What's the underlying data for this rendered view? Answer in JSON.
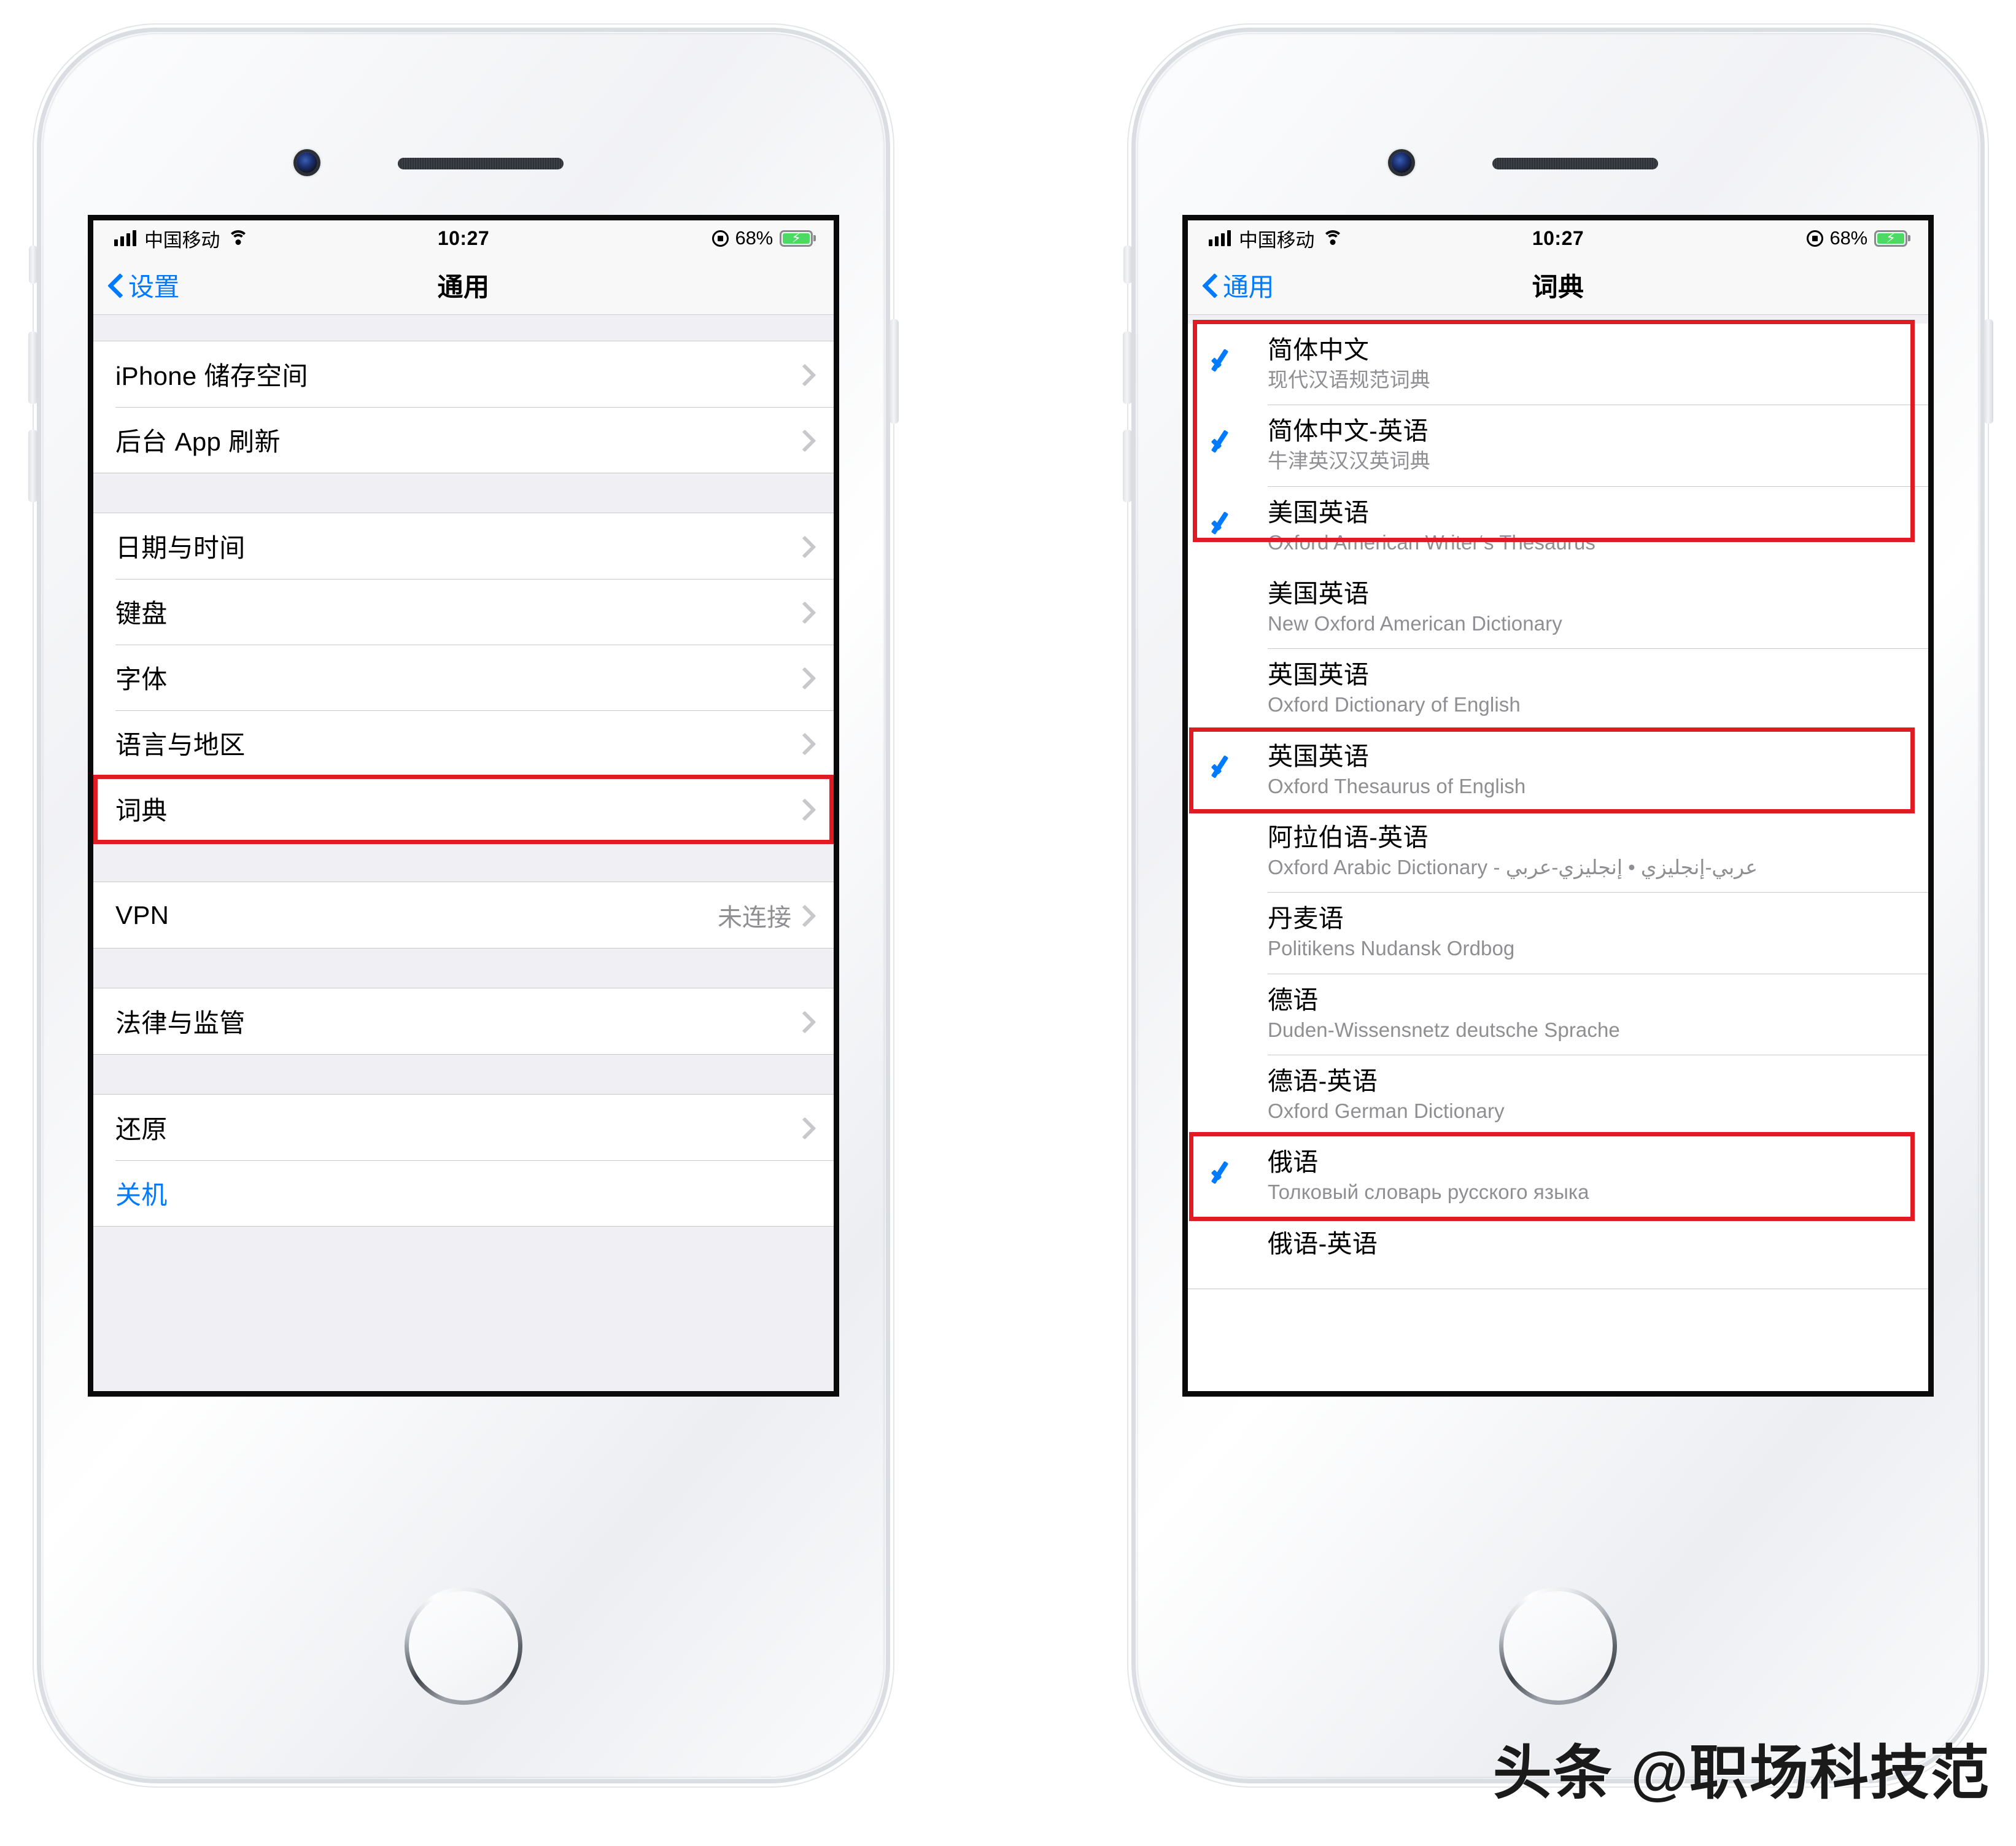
{
  "status_bar": {
    "carrier": "中国移动",
    "time": "10:27",
    "battery_percent": "68%",
    "signal_icon": "signal-bars-icon",
    "wifi_icon": "wifi-icon",
    "rotation_lock_icon": "rotation-lock-icon",
    "battery_icon": "battery-charging-icon"
  },
  "left_phone": {
    "nav": {
      "back_label": "设置",
      "title": "通用",
      "back_icon": "chevron-left-icon"
    },
    "groups": [
      {
        "rows": [
          {
            "label": "iPhone 储存空间",
            "value": "",
            "accessory": "chevron-right-icon"
          },
          {
            "label": "后台 App 刷新",
            "value": "",
            "accessory": "chevron-right-icon"
          }
        ]
      },
      {
        "rows": [
          {
            "label": "日期与时间",
            "value": "",
            "accessory": "chevron-right-icon"
          },
          {
            "label": "键盘",
            "value": "",
            "accessory": "chevron-right-icon"
          },
          {
            "label": "字体",
            "value": "",
            "accessory": "chevron-right-icon"
          },
          {
            "label": "语言与地区",
            "value": "",
            "accessory": "chevron-right-icon"
          },
          {
            "label": "词典",
            "value": "",
            "accessory": "chevron-right-icon",
            "highlighted": true
          }
        ]
      },
      {
        "rows": [
          {
            "label": "VPN",
            "value": "未连接",
            "accessory": "chevron-right-icon"
          }
        ]
      },
      {
        "rows": [
          {
            "label": "法律与监管",
            "value": "",
            "accessory": "chevron-right-icon"
          }
        ]
      },
      {
        "rows": [
          {
            "label": "还原",
            "value": "",
            "accessory": "chevron-right-icon"
          },
          {
            "label": "关机",
            "value": "",
            "accessory": "",
            "style": "blue"
          }
        ]
      }
    ]
  },
  "right_phone": {
    "nav": {
      "back_label": "通用",
      "title": "词典",
      "back_icon": "chevron-left-icon"
    },
    "dictionaries": [
      {
        "title": "简体中文",
        "subtitle": "现代汉语规范词典",
        "checked": true
      },
      {
        "title": "简体中文-英语",
        "subtitle": "牛津英汉汉英词典",
        "checked": true
      },
      {
        "title": "美国英语",
        "subtitle": "Oxford American Writer‘s Thesaurus",
        "checked": true
      },
      {
        "title": "美国英语",
        "subtitle": "New Oxford American Dictionary",
        "checked": false
      },
      {
        "title": "英国英语",
        "subtitle": "Oxford Dictionary of English",
        "checked": false
      },
      {
        "title": "英国英语",
        "subtitle": "Oxford Thesaurus of English",
        "checked": true
      },
      {
        "title": "阿拉伯语-英语",
        "subtitle": "Oxford Arabic Dictionary - عربي-إنجليزي • إنجليزي-عربي",
        "checked": false
      },
      {
        "title": "丹麦语",
        "subtitle": "Politikens Nudansk Ordbog",
        "checked": false
      },
      {
        "title": "德语",
        "subtitle": "Duden-Wissensnetz deutsche Sprache",
        "checked": false
      },
      {
        "title": "德语-英语",
        "subtitle": "Oxford German Dictionary",
        "checked": false
      },
      {
        "title": "俄语",
        "subtitle": "Толковый словарь русского языка",
        "checked": true
      },
      {
        "title": "俄语-英语",
        "subtitle": "",
        "checked": false
      }
    ]
  },
  "watermark": "头条 @职场科技范",
  "colors": {
    "accent_blue": "#007aff",
    "highlight_red": "#e01b22",
    "battery_green": "#4cd964",
    "group_bg": "#efeff4",
    "separator": "#c8c7cc",
    "secondary_text": "#8e8e93"
  }
}
